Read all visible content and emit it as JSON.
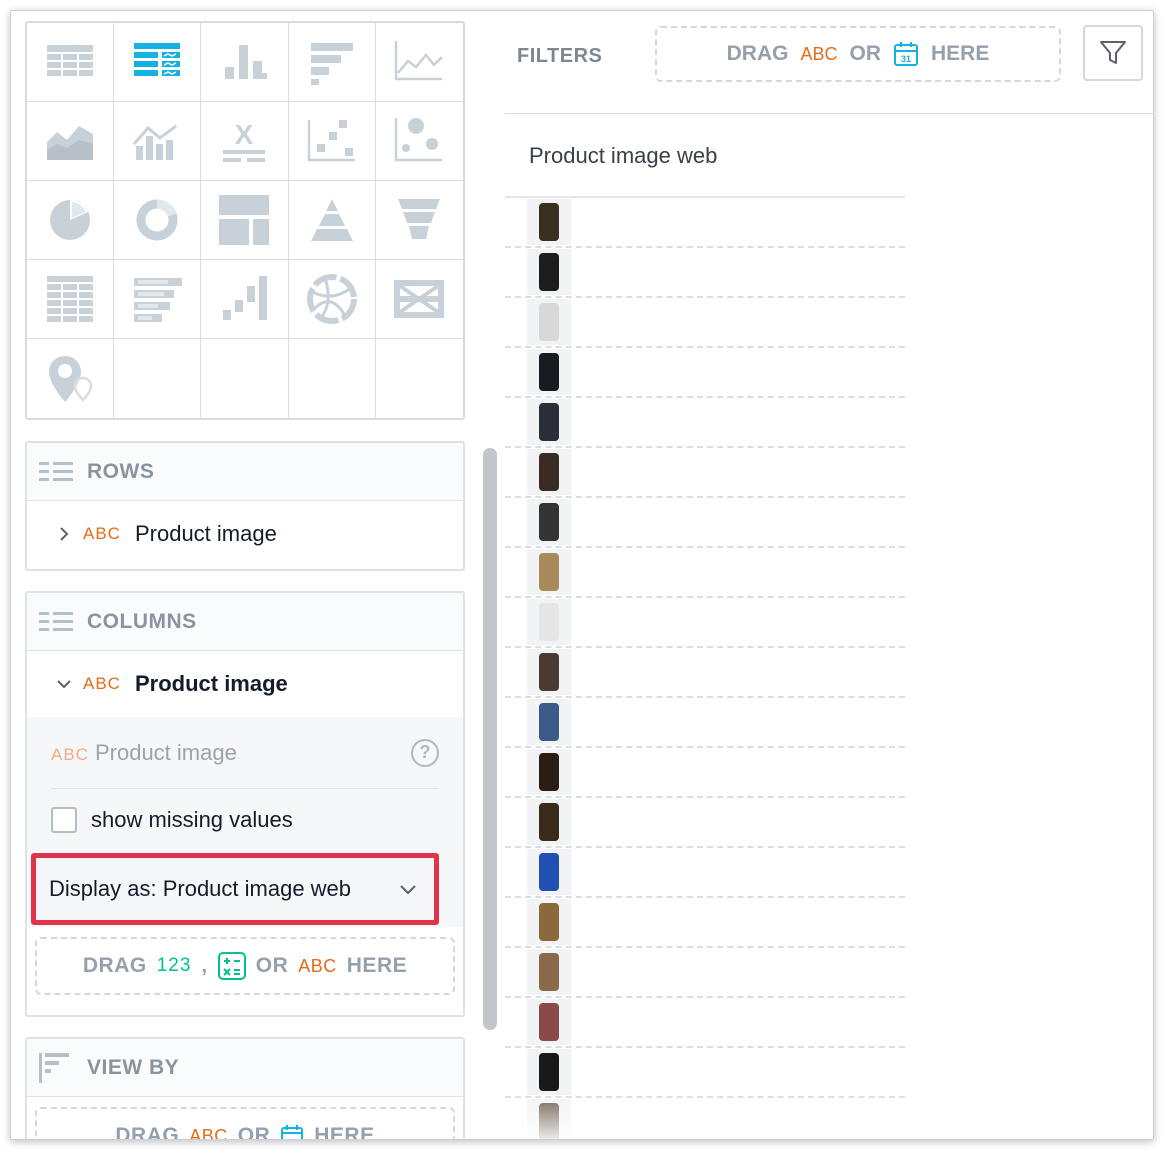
{
  "viz_types": [
    {
      "name": "table",
      "icon": "table-icon"
    },
    {
      "name": "headline",
      "icon": "headline-table-icon"
    },
    {
      "name": "column",
      "icon": "column-chart-icon"
    },
    {
      "name": "bar",
      "icon": "bar-chart-icon"
    },
    {
      "name": "line",
      "icon": "line-chart-icon"
    },
    {
      "name": "area",
      "icon": "area-chart-icon"
    },
    {
      "name": "combo",
      "icon": "combo-chart-icon"
    },
    {
      "name": "xirr",
      "icon": "xirr-icon"
    },
    {
      "name": "heatmap-scatter",
      "icon": "scatter-plot-icon"
    },
    {
      "name": "bubble",
      "icon": "bubble-chart-icon"
    },
    {
      "name": "pie",
      "icon": "pie-chart-icon"
    },
    {
      "name": "donut",
      "icon": "donut-chart-icon"
    },
    {
      "name": "treemap",
      "icon": "treemap-icon"
    },
    {
      "name": "pyramid",
      "icon": "pyramid-chart-icon"
    },
    {
      "name": "funnel",
      "icon": "funnel-chart-icon"
    },
    {
      "name": "heatmap",
      "icon": "heatmap-icon"
    },
    {
      "name": "bullet",
      "icon": "bullet-chart-icon"
    },
    {
      "name": "waterfall",
      "icon": "waterfall-chart-icon"
    },
    {
      "name": "dependency-wheel",
      "icon": "dependency-wheel-icon"
    },
    {
      "name": "sankey",
      "icon": "sankey-chart-icon"
    },
    {
      "name": "geo-pushpin",
      "icon": "geo-pushpin-icon"
    }
  ],
  "rows": {
    "title": "ROWS",
    "item": {
      "type_tag": "ABC",
      "label": "Product image"
    }
  },
  "columns": {
    "title": "COLUMNS",
    "item": {
      "type_tag": "ABC",
      "label": "Product image"
    },
    "config": {
      "attr_tag": "ABC",
      "attr_label": "Product image",
      "help": "?",
      "checkbox_label": "show missing values",
      "display_as": "Display as: Product image web"
    },
    "dropzone": {
      "drag": "DRAG",
      "num": "123",
      "comma": ",",
      "or": "OR",
      "abc": "ABC",
      "here": "HERE"
    }
  },
  "view_by": {
    "title": "VIEW BY",
    "dropzone": {
      "drag": "DRAG",
      "abc": "ABC",
      "or": "OR",
      "here": "HERE"
    }
  },
  "filters": {
    "label": "FILTERS",
    "drop": {
      "drag": "DRAG",
      "abc": "ABC",
      "or": "OR",
      "here": "HERE",
      "cal_day": "31"
    }
  },
  "table": {
    "column_header": "Product image web",
    "rows": [
      {
        "thumb": "puffer-jacket",
        "color": "#3a3020"
      },
      {
        "thumb": "joggers",
        "color": "#1c1c1c"
      },
      {
        "thumb": "appliance",
        "color": "#d8d8d8"
      },
      {
        "thumb": "earbuds",
        "color": "#1a1a22"
      },
      {
        "thumb": "jacket-man",
        "color": "#2a2e38"
      },
      {
        "thumb": "furniture",
        "color": "#3a2c22"
      },
      {
        "thumb": "speakers",
        "color": "#333333"
      },
      {
        "thumb": "parka",
        "color": "#a88a5a"
      },
      {
        "thumb": "white-device",
        "color": "#e6e6e6"
      },
      {
        "thumb": "man-portrait",
        "color": "#4a3a34"
      },
      {
        "thumb": "jeans",
        "color": "#3a5a8a"
      },
      {
        "thumb": "side-table",
        "color": "#2a1e14"
      },
      {
        "thumb": "cabinet",
        "color": "#3a2a1a"
      },
      {
        "thumb": "box-package",
        "color": "#2050b0"
      },
      {
        "thumb": "khaki-pants",
        "color": "#8a6a3a"
      },
      {
        "thumb": "pouf",
        "color": "#8a6a4a"
      },
      {
        "thumb": "poster",
        "color": "#8a4a4a"
      },
      {
        "thumb": "black-dress",
        "color": "#181818"
      },
      {
        "thumb": "small-item",
        "color": "#6a5a4a"
      }
    ]
  },
  "colors": {
    "accent_orange": "#e46b1a",
    "accent_green": "#00c18e",
    "highlight_red": "#e0344a",
    "icon_gray": "#c9d1d8",
    "icon_blue": "#14b2e2"
  }
}
